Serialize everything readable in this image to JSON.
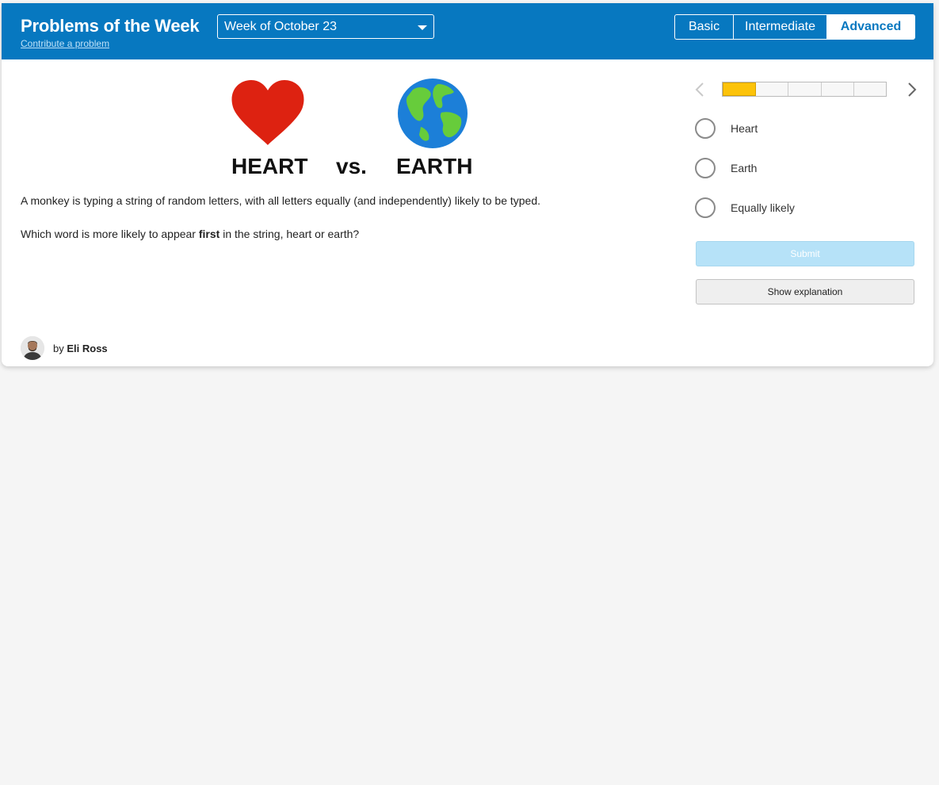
{
  "header": {
    "title": "Problems of the Week",
    "contribute_link": "Contribute a problem",
    "week_select": "Week of October 23",
    "levels": [
      "Basic",
      "Intermediate",
      "Advanced"
    ],
    "active_level": "Advanced",
    "accent_color": "#0778c0"
  },
  "figure": {
    "left_label": "HEART",
    "vs_label": "vs.",
    "right_label": "EARTH",
    "left_icon": "heart-icon",
    "right_icon": "globe-icon"
  },
  "problem": {
    "statement": "A monkey is typing a string of random letters, with all letters equally (and independently) likely to be typed.",
    "question_before": "Which word is more likely to appear ",
    "question_bold": "first",
    "question_after": " in the string, heart or earth?"
  },
  "navigation": {
    "progress_segments": 5,
    "current_segment": 1,
    "progress_color": "#fcc30a"
  },
  "options": [
    "Heart",
    "Earth",
    "Equally likely"
  ],
  "buttons": {
    "submit": "Submit",
    "explanation": "Show explanation"
  },
  "author": {
    "prefix": "by",
    "name": "Eli Ross"
  }
}
